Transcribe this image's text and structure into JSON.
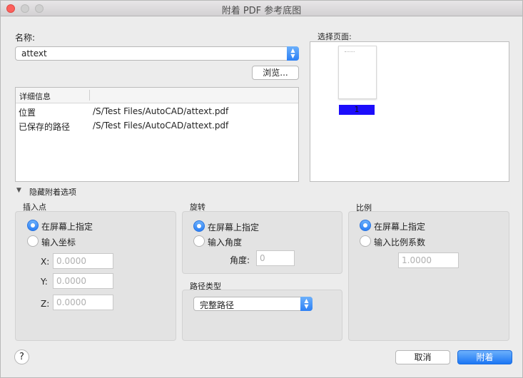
{
  "window": {
    "title": "附着 PDF 参考底图"
  },
  "name_section": {
    "label": "名称:",
    "selected": "attext"
  },
  "browse_label": "浏览...",
  "details": {
    "header": "详细信息",
    "rows": [
      {
        "key": "位置",
        "value": "/S/Test Files/AutoCAD/attext.pdf"
      },
      {
        "key": "已保存的路径",
        "value": "/S/Test Files/AutoCAD/attext.pdf"
      }
    ]
  },
  "page_select": {
    "label": "选择页面:",
    "page_number": "1"
  },
  "hide_options_label": "隐藏附着选项",
  "insertion": {
    "title": "插入点",
    "opt_screen": "在屏幕上指定",
    "opt_coords": "输入坐标",
    "x_label": "X:",
    "x_placeholder": "0.0000",
    "y_label": "Y:",
    "y_placeholder": "0.0000",
    "z_label": "Z:",
    "z_placeholder": "0.0000"
  },
  "rotation": {
    "title": "旋转",
    "opt_screen": "在屏幕上指定",
    "opt_angle": "输入角度",
    "angle_label": "角度:",
    "angle_placeholder": "0"
  },
  "path_type": {
    "title": "路径类型",
    "selected": "完整路径"
  },
  "scale": {
    "title": "比例",
    "opt_screen": "在屏幕上指定",
    "opt_factor": "输入比例系数",
    "factor_placeholder": "1.0000"
  },
  "footer": {
    "help": "?",
    "cancel": "取消",
    "attach": "附着"
  },
  "colors": {
    "accent": "#2c80f5",
    "page_highlight": "#1c0dfb",
    "close": "#fc605c"
  }
}
